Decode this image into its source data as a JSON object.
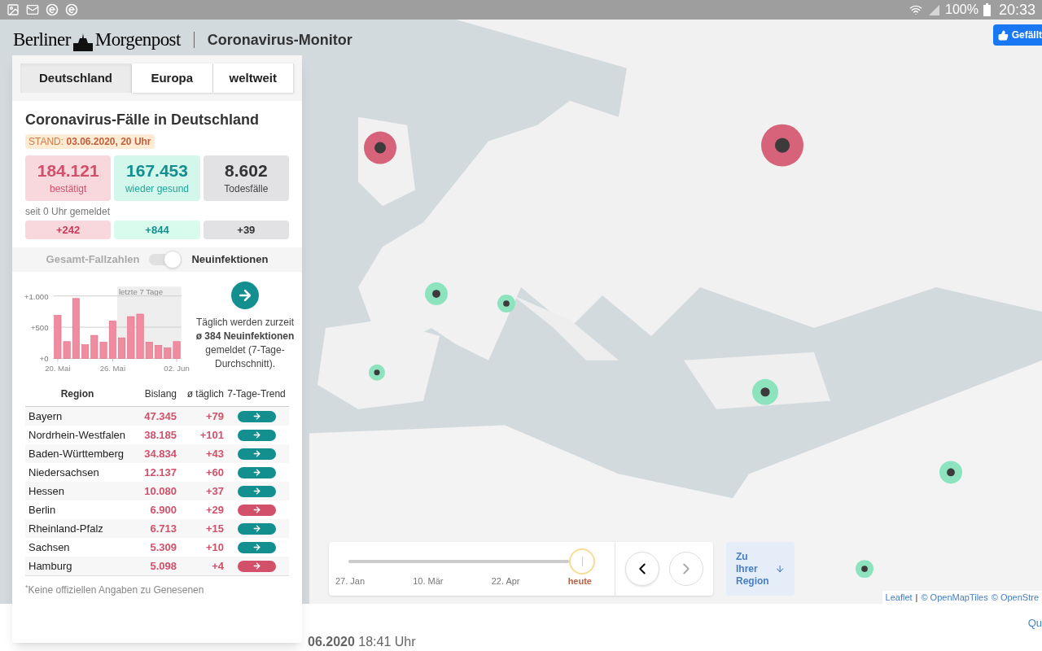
{
  "status_bar": {
    "battery": "100%",
    "time": "20:33"
  },
  "header": {
    "brand_left": "Berliner",
    "brand_right": "Morgenpost",
    "title": "Coronavirus-Monitor"
  },
  "like_button": {
    "label": "Gefällt"
  },
  "panel": {
    "tabs": [
      {
        "label": "Deutschland",
        "selected": true
      },
      {
        "label": "Europa",
        "selected": false
      },
      {
        "label": "weltweit",
        "selected": false
      }
    ],
    "heading": "Coronavirus-Fälle in Deutschland",
    "stand_label": "STAND:",
    "stand_value": "03.06.2020, 20 Uhr",
    "stats": [
      {
        "kind": "confirmed",
        "value": "184.121",
        "label": "bestätigt",
        "delta": "+242"
      },
      {
        "kind": "recovered",
        "value": "167.453",
        "label": "wieder gesund",
        "delta": "+844"
      },
      {
        "kind": "deaths",
        "value": "8.602",
        "label": "Todesfälle",
        "delta": "+39"
      }
    ],
    "since_label": "seit 0 Uhr gemeldet",
    "toggle": {
      "left_label": "Gesamt-Fallzahlen",
      "right_label": "Neuinfektionen",
      "on": true
    },
    "chart_data": {
      "type": "bar",
      "categories": [
        "20. Mai",
        null,
        null,
        null,
        null,
        null,
        "26. Mai",
        null,
        null,
        null,
        null,
        null,
        null,
        "02. Jun"
      ],
      "values": [
        690,
        270,
        960,
        220,
        370,
        260,
        600,
        330,
        670,
        710,
        260,
        210,
        170,
        270
      ],
      "ylim": [
        0,
        1000
      ],
      "yticks": [
        {
          "value": 0,
          "label": "+0"
        },
        {
          "value": 500,
          "label": "+500"
        },
        {
          "value": 1000,
          "label": "+1.000"
        }
      ],
      "annotations": [
        {
          "text": "letzte 7 Tage"
        }
      ]
    },
    "trend_note": "Täglich werden zurzeit **ø 384 Neuinfektionen** gemeldet (7-Tage-Durchschnitt).",
    "table": {
      "columns": [
        "Region",
        "Bislang",
        "ø täglich",
        "7-Tage-Trend"
      ],
      "rows": [
        {
          "region": "Bayern",
          "total": "47.345",
          "daily": "+79",
          "color": "#138f8f"
        },
        {
          "region": "Nordrhein-Westfalen",
          "total": "38.185",
          "daily": "+101",
          "color": "#138f8f"
        },
        {
          "region": "Baden-Württemberg",
          "total": "34.834",
          "daily": "+43",
          "color": "#138f8f"
        },
        {
          "region": "Niedersachsen",
          "total": "12.137",
          "daily": "+60",
          "color": "#138f8f"
        },
        {
          "region": "Hessen",
          "total": "10.080",
          "daily": "+37",
          "color": "#138f8f"
        },
        {
          "region": "Berlin",
          "total": "6.900",
          "daily": "+29",
          "color": "#d2506a"
        },
        {
          "region": "Rheinland-Pfalz",
          "total": "6.713",
          "daily": "+15",
          "color": "#138f8f"
        },
        {
          "region": "Sachsen",
          "total": "5.309",
          "daily": "+10",
          "color": "#138f8f"
        },
        {
          "region": "Hamburg",
          "total": "5.098",
          "daily": "+4",
          "color": "#d2506a"
        }
      ]
    },
    "footnote": "$^{*}$Keine offiziellen Angaben zu Genesenen"
  },
  "timeline": {
    "level": 1,
    "labels": [
      {
        "text": "27. Jan",
        "selected": false
      },
      {
        "text": "10. Mär",
        "selected": false
      },
      {
        "text": "22. Apr",
        "selected": false
      },
      {
        "text": "heute",
        "selected": true
      }
    ],
    "prev_button": {
      "disabled": false
    },
    "next_button": {
      "disabled": true
    }
  },
  "region_button": {
    "label": "Zu Ihrer Region"
  },
  "attribution": {
    "links": [
      "Leaflet",
      "© OpenMapTiles",
      "© OpenStre"
    ],
    "separator": "|"
  },
  "footer": {
    "date": "06.2020",
    "time": "18:41 Uhr",
    "link": "Qu"
  }
}
